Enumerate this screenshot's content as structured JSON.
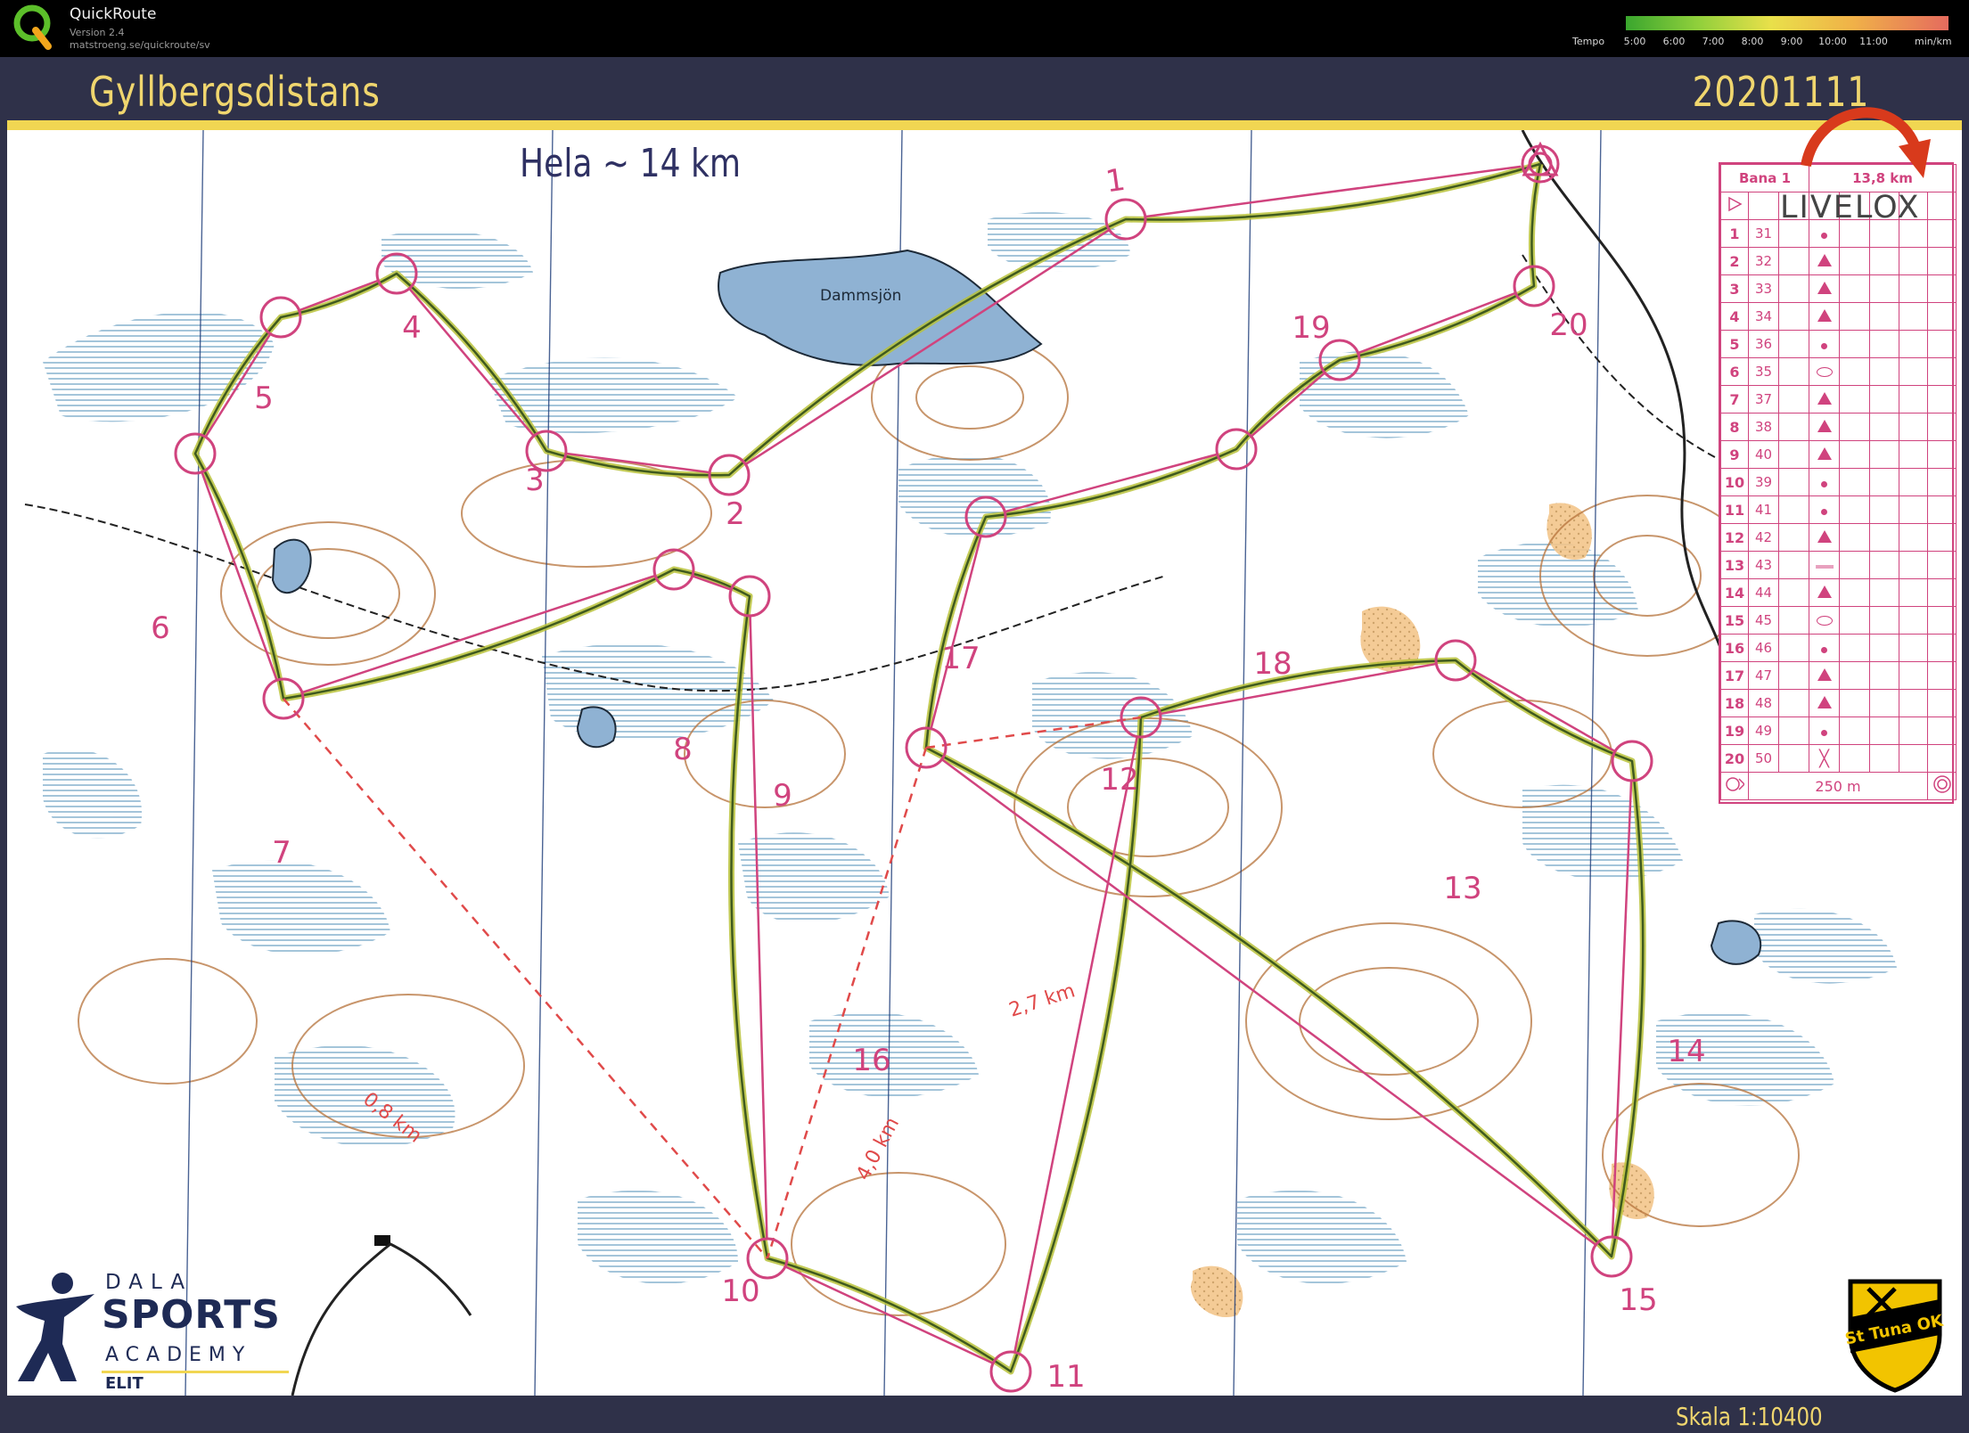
{
  "app": {
    "name": "QuickRoute",
    "version": "Version 2.4",
    "url": "matstroeng.se/quickroute/sv"
  },
  "tempo_legend": {
    "label": "Tempo",
    "ticks": [
      "5:00",
      "6:00",
      "7:00",
      "8:00",
      "9:00",
      "10:00",
      "11:00"
    ],
    "unit": "min/km"
  },
  "map": {
    "title": "Gyllbergsdistans",
    "date": "20201111",
    "course_note": "Hela ~ 14 km",
    "scale": "Skala 1:10400",
    "lake_label": "Dammsjön",
    "colors": {
      "course": "#d0437e",
      "route": "#3f5a1e",
      "route_highlight": "#b8c23a",
      "water": "#8fb2d3",
      "marsh": "#5a96bd",
      "contour": "#b5723a",
      "open_land": "#f3c58a",
      "frame": "#2f3149",
      "accent": "#f0d66e"
    },
    "leg_distances": [
      {
        "label": "0,8 km"
      },
      {
        "label": "2,7 km"
      },
      {
        "label": "4,0 km"
      }
    ]
  },
  "controls": [
    {
      "number": "1",
      "code": "31",
      "symbol": "dot"
    },
    {
      "number": "2",
      "code": "32",
      "symbol": "triangle"
    },
    {
      "number": "3",
      "code": "33",
      "symbol": "triangle"
    },
    {
      "number": "4",
      "code": "34",
      "symbol": "triangle"
    },
    {
      "number": "5",
      "code": "36",
      "symbol": "dot"
    },
    {
      "number": "6",
      "code": "35",
      "symbol": "oval"
    },
    {
      "number": "7",
      "code": "37",
      "symbol": "triangle"
    },
    {
      "number": "8",
      "code": "38",
      "symbol": "triangle"
    },
    {
      "number": "9",
      "code": "40",
      "symbol": "triangle"
    },
    {
      "number": "10",
      "code": "39",
      "symbol": "dot"
    },
    {
      "number": "11",
      "code": "41",
      "symbol": "dot"
    },
    {
      "number": "12",
      "code": "42",
      "symbol": "triangle"
    },
    {
      "number": "13",
      "code": "43",
      "symbol": "line"
    },
    {
      "number": "14",
      "code": "44",
      "symbol": "triangle"
    },
    {
      "number": "15",
      "code": "45",
      "symbol": "oval"
    },
    {
      "number": "16",
      "code": "46",
      "symbol": "dot"
    },
    {
      "number": "17",
      "code": "47",
      "symbol": "triangle"
    },
    {
      "number": "18",
      "code": "48",
      "symbol": "triangle"
    },
    {
      "number": "19",
      "code": "49",
      "symbol": "dot"
    },
    {
      "number": "20",
      "code": "50",
      "symbol": "cross"
    }
  ],
  "description_sheet": {
    "course": "Bana 1",
    "length": "13,8 km",
    "finish_distance": "250 m"
  },
  "overlay": {
    "livelox": "LIVELOX"
  },
  "sponsor": {
    "line1": "DALA",
    "line2": "SPORTS",
    "line3": "ACADEMY",
    "line4": "ELIT"
  },
  "club_logo_text": "St Tuna OK"
}
